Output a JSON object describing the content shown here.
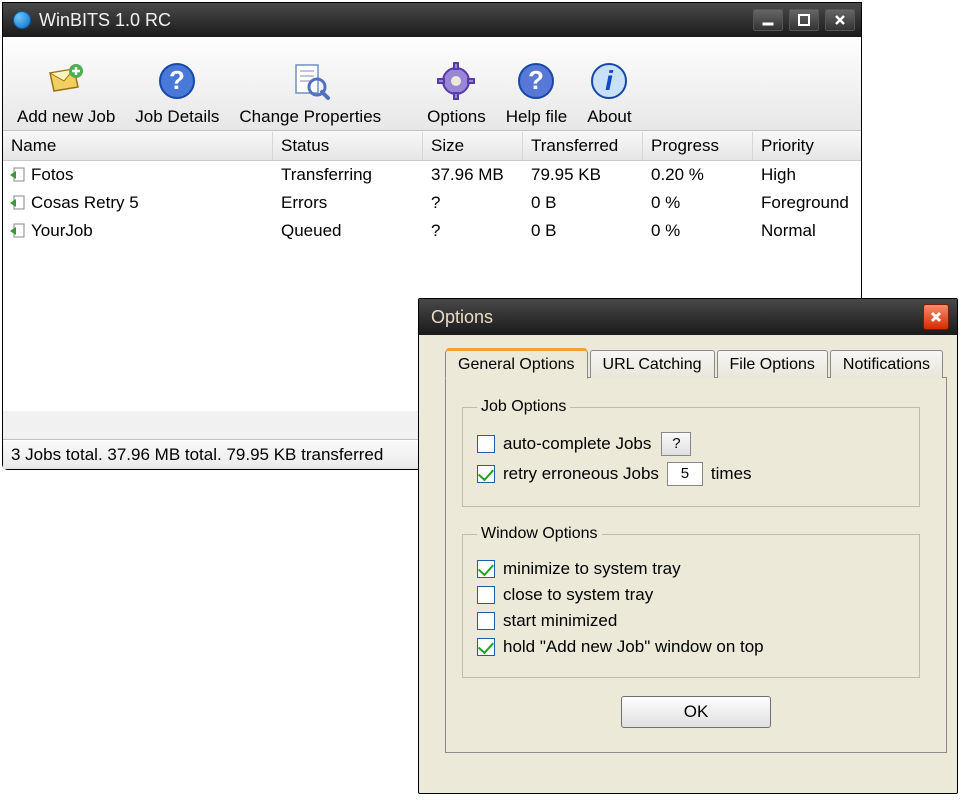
{
  "main": {
    "title": "WinBITS 1.0 RC",
    "toolbar": [
      {
        "name": "add-new-job",
        "label": "Add new Job",
        "icon": "envelope-add"
      },
      {
        "name": "job-details",
        "label": "Job Details",
        "icon": "info-qmark"
      },
      {
        "name": "change-properties",
        "label": "Change Properties",
        "icon": "properties"
      },
      {
        "sep": true
      },
      {
        "name": "options",
        "label": "Options",
        "icon": "gear"
      },
      {
        "name": "help-file",
        "label": "Help file",
        "icon": "help"
      },
      {
        "name": "about",
        "label": "About",
        "icon": "about"
      }
    ],
    "columns": [
      "Name",
      "Status",
      "Size",
      "Transferred",
      "Progress",
      "Priority"
    ],
    "rows": [
      {
        "name": "Fotos",
        "status": "Transferring",
        "size": "37.96 MB",
        "transferred": "79.95 KB",
        "progress": "0.20 %",
        "priority": "High"
      },
      {
        "name": "Cosas Retry 5",
        "status": "Errors",
        "size": "?",
        "transferred": "0 B",
        "progress": "0 %",
        "priority": "Foreground"
      },
      {
        "name": "YourJob",
        "status": "Queued",
        "size": "?",
        "transferred": "0 B",
        "progress": "0 %",
        "priority": "Normal"
      }
    ],
    "status": "3 Jobs total. 37.96 MB total. 79.95 KB transferred"
  },
  "options": {
    "title": "Options",
    "tabs": [
      "General Options",
      "URL Catching",
      "File Options",
      "Notifications"
    ],
    "active_tab": 0,
    "job_options": {
      "legend": "Job Options",
      "auto_complete": {
        "checked": false,
        "label": "auto-complete Jobs"
      },
      "retry": {
        "checked": true,
        "label": "retry erroneous Jobs",
        "value": "5",
        "suffix": "times"
      }
    },
    "window_options": {
      "legend": "Window Options",
      "items": [
        {
          "checked": true,
          "label": "minimize to system tray"
        },
        {
          "checked": false,
          "label": "close to system tray"
        },
        {
          "checked": false,
          "label": "start minimized"
        },
        {
          "checked": true,
          "label": "hold \"Add new Job\" window on top"
        }
      ]
    },
    "ok": "OK",
    "help": "?"
  }
}
